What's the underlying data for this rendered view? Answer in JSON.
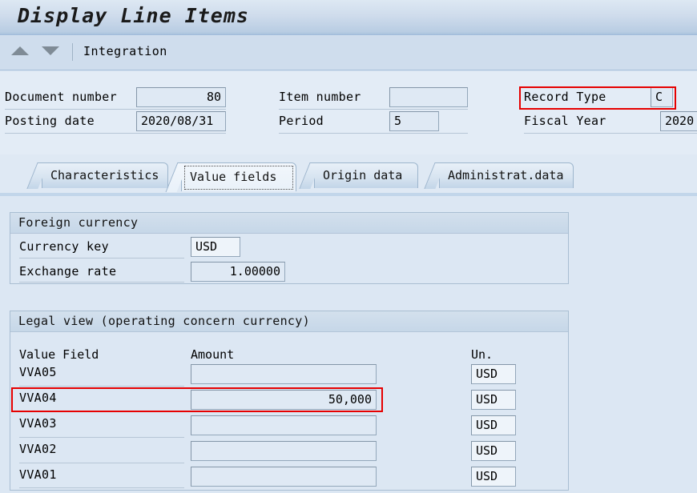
{
  "window": {
    "title": "Display Line Items"
  },
  "toolbar": {
    "up_icon": "triangle-up-icon",
    "down_icon": "triangle-down-icon",
    "label": "Integration"
  },
  "header_fields": {
    "document_number": {
      "label": "Document number",
      "value": "80"
    },
    "posting_date": {
      "label": "Posting date",
      "value": "2020/08/31"
    },
    "item_number": {
      "label": "Item number",
      "value": ""
    },
    "period": {
      "label": "Period",
      "value": "5"
    },
    "record_type": {
      "label": "Record Type",
      "value": "C",
      "highlight_color": "#e60000"
    },
    "fiscal_year": {
      "label": "Fiscal Year",
      "value": "2020"
    }
  },
  "tabs": [
    {
      "label": "Characteristics",
      "active": false
    },
    {
      "label": "Value fields",
      "active": true
    },
    {
      "label": "Origin data",
      "active": false
    },
    {
      "label": "Administrat.data",
      "active": false
    }
  ],
  "foreign_currency": {
    "title": "Foreign currency",
    "currency_key": {
      "label": "Currency key",
      "value": "USD"
    },
    "exchange_rate": {
      "label": "Exchange rate",
      "value": "1.00000"
    }
  },
  "legal_view": {
    "title": "Legal view (operating concern currency)",
    "columns": [
      "Value Field",
      "Amount",
      "Un."
    ],
    "rows": [
      {
        "field": "VVA05",
        "amount": "",
        "unit": "USD",
        "highlighted": false
      },
      {
        "field": "VVA04",
        "amount": "50,000",
        "unit": "USD",
        "highlighted": true
      },
      {
        "field": "VVA03",
        "amount": "",
        "unit": "USD",
        "highlighted": false
      },
      {
        "field": "VVA02",
        "amount": "",
        "unit": "USD",
        "highlighted": false
      },
      {
        "field": "VVA01",
        "amount": "",
        "unit": "USD",
        "highlighted": false
      }
    ],
    "highlight_color": "#e60000"
  }
}
